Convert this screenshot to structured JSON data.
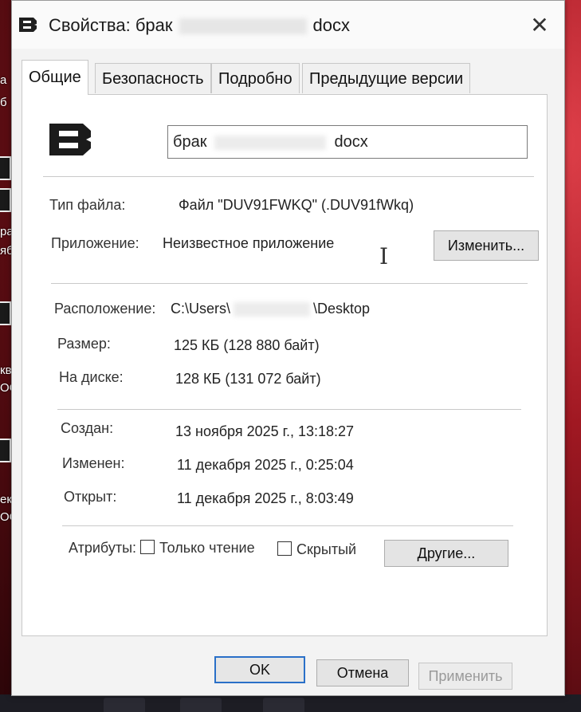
{
  "window": {
    "title_prefix": "Свойства: брак",
    "title_suffix": "docx",
    "close_glyph": "✕"
  },
  "tabs": [
    {
      "label": "Общие",
      "active": true
    },
    {
      "label": "Безопасность",
      "active": false
    },
    {
      "label": "Подробно",
      "active": false
    },
    {
      "label": "Предыдущие версии",
      "active": false
    }
  ],
  "file": {
    "name_prefix": "брак",
    "name_suffix": "docx"
  },
  "info": {
    "type_label": "Тип файла:",
    "type_value": "Файл \"DUV91FWKQ\" (.DUV91fWkq)",
    "app_label": "Приложение:",
    "app_value": "Неизвестное приложение",
    "change_button": "Изменить...",
    "location_label": "Расположение:",
    "location_prefix": "C:\\Users\\",
    "location_suffix": "\\Desktop",
    "size_label": "Размер:",
    "size_value": "125 КБ (128 880 байт)",
    "disk_label": "На диске:",
    "disk_value": "128 КБ (131 072 байт)",
    "created_label": "Создан:",
    "created_value": "13 ноября 2025 г., 13:18:27",
    "modified_label": "Изменен:",
    "modified_value": "11 декабря 2025 г., 0:25:04",
    "opened_label": "Открыт:",
    "opened_value": "11 декабря 2025 г., 8:03:49"
  },
  "attributes": {
    "label": "Атрибуты:",
    "readonly_label": "Только чтение",
    "readonly_checked": false,
    "hidden_label": "Скрытый",
    "hidden_checked": false,
    "other_button": "Другие..."
  },
  "footer": {
    "ok": "OK",
    "cancel": "Отмена",
    "apply": "Применить"
  },
  "desktop": {
    "frag1": "а",
    "frag2": "б",
    "frag3": "ра",
    "frag4": "яб",
    "frag5": "кви",
    "frag6": "ОО И",
    "frag7": "екви",
    "frag8": "ООО Н"
  }
}
